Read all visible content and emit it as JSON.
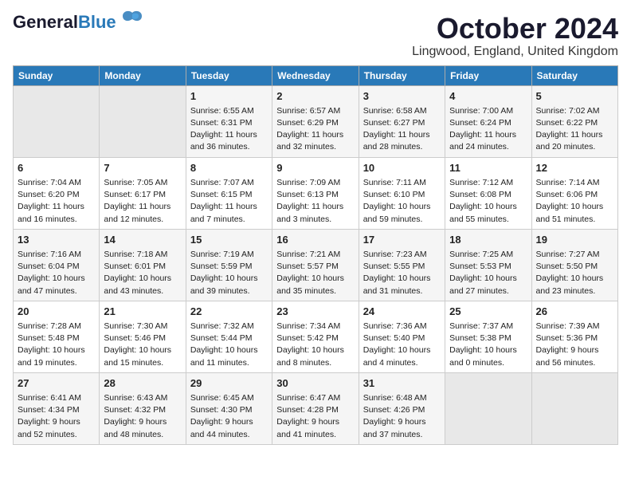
{
  "header": {
    "logo_line1": "General",
    "logo_line2": "Blue",
    "month_year": "October 2024",
    "location": "Lingwood, England, United Kingdom"
  },
  "days_of_week": [
    "Sunday",
    "Monday",
    "Tuesday",
    "Wednesday",
    "Thursday",
    "Friday",
    "Saturday"
  ],
  "weeks": [
    [
      {
        "day": "",
        "info": ""
      },
      {
        "day": "",
        "info": ""
      },
      {
        "day": "1",
        "info": "Sunrise: 6:55 AM\nSunset: 6:31 PM\nDaylight: 11 hours\nand 36 minutes."
      },
      {
        "day": "2",
        "info": "Sunrise: 6:57 AM\nSunset: 6:29 PM\nDaylight: 11 hours\nand 32 minutes."
      },
      {
        "day": "3",
        "info": "Sunrise: 6:58 AM\nSunset: 6:27 PM\nDaylight: 11 hours\nand 28 minutes."
      },
      {
        "day": "4",
        "info": "Sunrise: 7:00 AM\nSunset: 6:24 PM\nDaylight: 11 hours\nand 24 minutes."
      },
      {
        "day": "5",
        "info": "Sunrise: 7:02 AM\nSunset: 6:22 PM\nDaylight: 11 hours\nand 20 minutes."
      }
    ],
    [
      {
        "day": "6",
        "info": "Sunrise: 7:04 AM\nSunset: 6:20 PM\nDaylight: 11 hours\nand 16 minutes."
      },
      {
        "day": "7",
        "info": "Sunrise: 7:05 AM\nSunset: 6:17 PM\nDaylight: 11 hours\nand 12 minutes."
      },
      {
        "day": "8",
        "info": "Sunrise: 7:07 AM\nSunset: 6:15 PM\nDaylight: 11 hours\nand 7 minutes."
      },
      {
        "day": "9",
        "info": "Sunrise: 7:09 AM\nSunset: 6:13 PM\nDaylight: 11 hours\nand 3 minutes."
      },
      {
        "day": "10",
        "info": "Sunrise: 7:11 AM\nSunset: 6:10 PM\nDaylight: 10 hours\nand 59 minutes."
      },
      {
        "day": "11",
        "info": "Sunrise: 7:12 AM\nSunset: 6:08 PM\nDaylight: 10 hours\nand 55 minutes."
      },
      {
        "day": "12",
        "info": "Sunrise: 7:14 AM\nSunset: 6:06 PM\nDaylight: 10 hours\nand 51 minutes."
      }
    ],
    [
      {
        "day": "13",
        "info": "Sunrise: 7:16 AM\nSunset: 6:04 PM\nDaylight: 10 hours\nand 47 minutes."
      },
      {
        "day": "14",
        "info": "Sunrise: 7:18 AM\nSunset: 6:01 PM\nDaylight: 10 hours\nand 43 minutes."
      },
      {
        "day": "15",
        "info": "Sunrise: 7:19 AM\nSunset: 5:59 PM\nDaylight: 10 hours\nand 39 minutes."
      },
      {
        "day": "16",
        "info": "Sunrise: 7:21 AM\nSunset: 5:57 PM\nDaylight: 10 hours\nand 35 minutes."
      },
      {
        "day": "17",
        "info": "Sunrise: 7:23 AM\nSunset: 5:55 PM\nDaylight: 10 hours\nand 31 minutes."
      },
      {
        "day": "18",
        "info": "Sunrise: 7:25 AM\nSunset: 5:53 PM\nDaylight: 10 hours\nand 27 minutes."
      },
      {
        "day": "19",
        "info": "Sunrise: 7:27 AM\nSunset: 5:50 PM\nDaylight: 10 hours\nand 23 minutes."
      }
    ],
    [
      {
        "day": "20",
        "info": "Sunrise: 7:28 AM\nSunset: 5:48 PM\nDaylight: 10 hours\nand 19 minutes."
      },
      {
        "day": "21",
        "info": "Sunrise: 7:30 AM\nSunset: 5:46 PM\nDaylight: 10 hours\nand 15 minutes."
      },
      {
        "day": "22",
        "info": "Sunrise: 7:32 AM\nSunset: 5:44 PM\nDaylight: 10 hours\nand 11 minutes."
      },
      {
        "day": "23",
        "info": "Sunrise: 7:34 AM\nSunset: 5:42 PM\nDaylight: 10 hours\nand 8 minutes."
      },
      {
        "day": "24",
        "info": "Sunrise: 7:36 AM\nSunset: 5:40 PM\nDaylight: 10 hours\nand 4 minutes."
      },
      {
        "day": "25",
        "info": "Sunrise: 7:37 AM\nSunset: 5:38 PM\nDaylight: 10 hours\nand 0 minutes."
      },
      {
        "day": "26",
        "info": "Sunrise: 7:39 AM\nSunset: 5:36 PM\nDaylight: 9 hours\nand 56 minutes."
      }
    ],
    [
      {
        "day": "27",
        "info": "Sunrise: 6:41 AM\nSunset: 4:34 PM\nDaylight: 9 hours\nand 52 minutes."
      },
      {
        "day": "28",
        "info": "Sunrise: 6:43 AM\nSunset: 4:32 PM\nDaylight: 9 hours\nand 48 minutes."
      },
      {
        "day": "29",
        "info": "Sunrise: 6:45 AM\nSunset: 4:30 PM\nDaylight: 9 hours\nand 44 minutes."
      },
      {
        "day": "30",
        "info": "Sunrise: 6:47 AM\nSunset: 4:28 PM\nDaylight: 9 hours\nand 41 minutes."
      },
      {
        "day": "31",
        "info": "Sunrise: 6:48 AM\nSunset: 4:26 PM\nDaylight: 9 hours\nand 37 minutes."
      },
      {
        "day": "",
        "info": ""
      },
      {
        "day": "",
        "info": ""
      }
    ]
  ]
}
